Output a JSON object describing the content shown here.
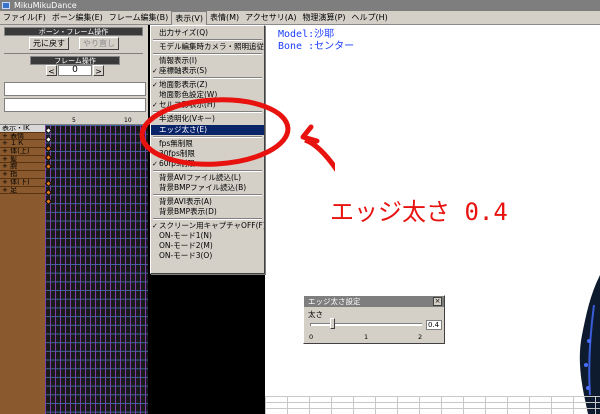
{
  "window": {
    "title": "MikuMikuDance"
  },
  "menubar": {
    "items": [
      {
        "label": "ファイル(F)"
      },
      {
        "label": "ボーン編集(E)"
      },
      {
        "label": "フレーム編集(B)"
      },
      {
        "label": "表示(V)"
      },
      {
        "label": "表情(M)"
      },
      {
        "label": "アクセサリ(A)"
      },
      {
        "label": "物理演算(P)"
      },
      {
        "label": "ヘルプ(H)"
      }
    ]
  },
  "left_panel": {
    "section_title": "ボーン・フレーム操作",
    "undo_label": "元に戻す",
    "redo_label": "やり直し",
    "frame_op_title": "フレーム操作",
    "prev_arrow": "<",
    "next_arrow": ">",
    "frame_number": "0",
    "timeline_scale_5": "5",
    "timeline_scale_10": "10",
    "bone_rows": [
      "表示・IK",
      "+ 表情",
      "+ ＩＫ",
      "+ 体(上)",
      "+ 髪",
      "+ 腕",
      "+ 指",
      "+ 体(下)",
      "+ 足"
    ]
  },
  "view_menu": {
    "items": [
      {
        "label": "出力サイズ(Q)",
        "checked": false
      },
      {
        "label": "モデル編集時カメラ・照明追従(C)",
        "checked": false
      },
      {
        "label": "情報表示(I)",
        "checked": false
      },
      {
        "label": "座標軸表示(S)",
        "checked": true
      },
      {
        "label": "地面影表示(Z)",
        "checked": true
      },
      {
        "label": "地面影色設定(W)",
        "checked": false
      },
      {
        "label": "セルフ影表示(H)",
        "checked": true
      },
      {
        "label": "半透明化(Vキー)",
        "checked": false
      },
      {
        "label": "エッジ太さ(E)",
        "checked": false,
        "highlighted": true
      },
      {
        "label": "fps無制限",
        "checked": false
      },
      {
        "label": "30fps制限",
        "checked": false
      },
      {
        "label": "60fps制限",
        "checked": true
      },
      {
        "label": "背景AVIファイル読込(L)",
        "checked": false
      },
      {
        "label": "背景BMPファイル読込(B)",
        "checked": false
      },
      {
        "label": "背景AVI表示(A)",
        "checked": false
      },
      {
        "label": "背景BMP表示(D)",
        "checked": false
      },
      {
        "label": "スクリーン用キャプチャOFF(F)",
        "checked": true
      },
      {
        "label": "ON-モード1(N)",
        "checked": false
      },
      {
        "label": "ON-モード2(M)",
        "checked": false
      },
      {
        "label": "ON-モード3(O)",
        "checked": false
      }
    ]
  },
  "viewport": {
    "model_info": "Model:沙耶",
    "bone_info": "Bone :センター"
  },
  "annotation": {
    "text": "エッジ太さ 0.4",
    "color": "#e8130f"
  },
  "edge_dialog": {
    "title": "エッジ太さ設定",
    "label": "太さ",
    "value": "0.4",
    "tick_0": "0",
    "tick_1": "1",
    "tick_2": "2",
    "slider_fraction": 0.2,
    "close_label": "×"
  },
  "colors": {
    "menu_highlight": "#0a246a",
    "overlay_text": "#1a3cff",
    "timeline_bg": "#8a5a2e"
  }
}
